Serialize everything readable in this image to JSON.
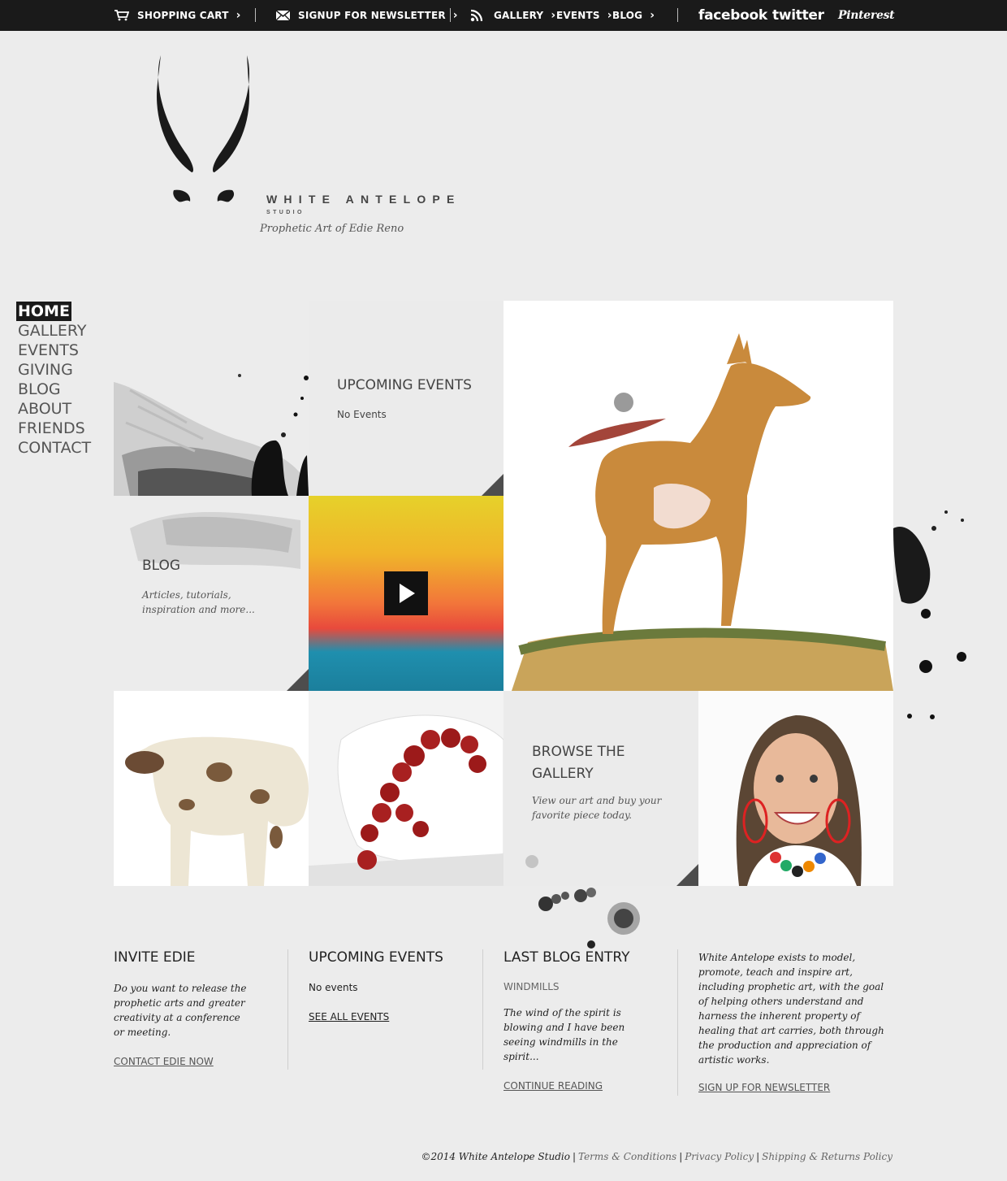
{
  "topbar": {
    "cart": "SHOPPING CART",
    "newsletter": "SIGNUP FOR NEWSLETTER",
    "gallery": "GALLERY",
    "events": "EVENTS",
    "blog": "BLOG",
    "facebook": "facebook",
    "twitter": "twitter",
    "pinterest": "Pinterest"
  },
  "brand": {
    "name": "WHITE ANTELOPE",
    "sub": "STUDIO",
    "tagline": "Prophetic Art of Edie Reno"
  },
  "nav": {
    "items": [
      "HOME",
      "GALLERY",
      "EVENTS",
      "GIVING",
      "BLOG",
      "ABOUT",
      "FRIENDS",
      "CONTACT"
    ],
    "active": "HOME"
  },
  "tiles": {
    "events_heading": "UPCOMING EVENTS",
    "events_text": "No Events",
    "blog_heading": "BLOG",
    "blog_text": "Articles, tutorials, inspiration and more...",
    "gallery_heading_1": "BROWSE THE",
    "gallery_heading_2": "GALLERY",
    "gallery_text": "View our art and buy your favorite piece today."
  },
  "footer": {
    "invite_title": "INVITE EDIE",
    "invite_text": "Do you want to release the prophetic arts and greater creativity at a conference or meeting.",
    "invite_link": "CONTACT EDIE NOW",
    "events_title": "UPCOMING EVENTS",
    "events_text": "No events",
    "events_link": "SEE ALL EVENTS",
    "blog_title": "LAST BLOG ENTRY",
    "blog_post_title": "WINDMILLS",
    "blog_excerpt": "The wind of the spirit is blowing and I have been seeing windmills in the spirit...",
    "blog_link": "CONTINUE READING",
    "about_text": "White Antelope exists to model, promote, teach and inspire art, including prophetic art, with the goal of helping others understand and harness the inherent property of healing that art carries, both through the production and appreciation of artistic works.",
    "about_link": "SIGN UP FOR NEWSLETTER"
  },
  "legal": {
    "copyright": "©2014 White Antelope Studio",
    "terms": "Terms & Conditions",
    "privacy": "Privacy Policy",
    "shipping": "Shipping & Returns Policy"
  },
  "colors": {
    "topbar_bg": "#1a1a1a",
    "page_bg": "#ececec",
    "corner_triangle": "#4d4d4d"
  }
}
